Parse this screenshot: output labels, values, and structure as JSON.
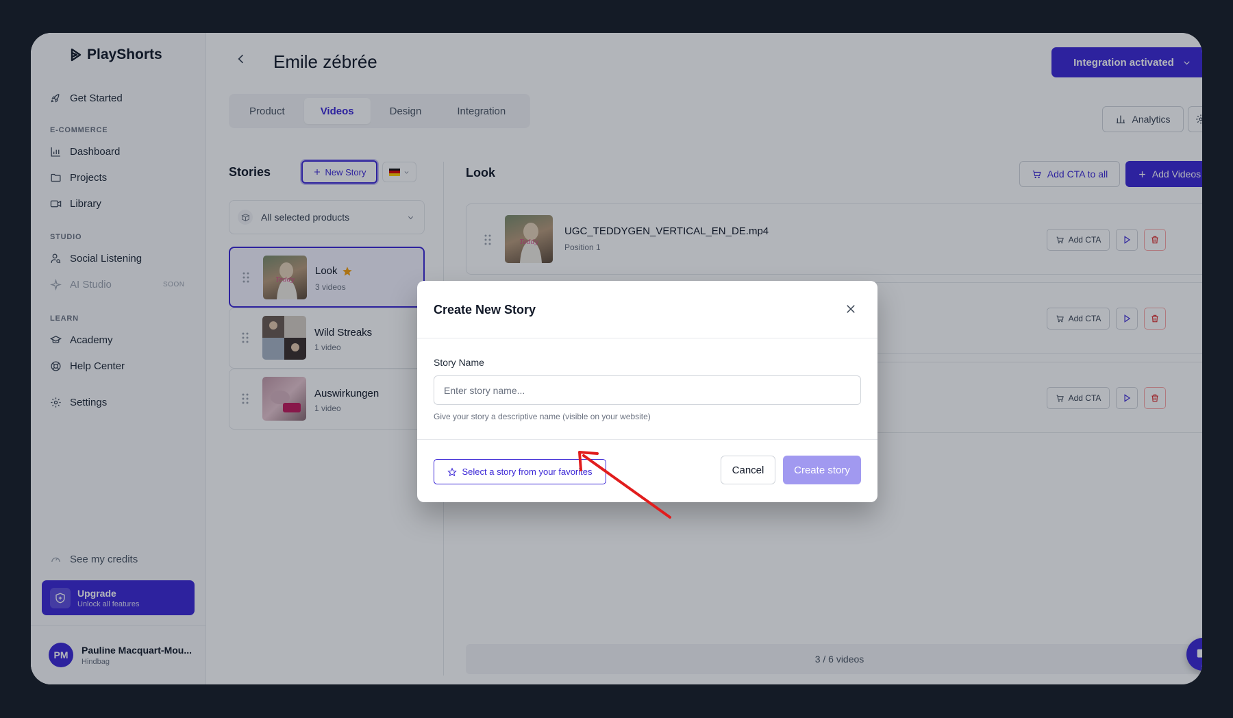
{
  "colors": {
    "accent": "#3b27d6",
    "danger": "#dc2626",
    "star": "#f59e0b",
    "annotation": "#e11d1d"
  },
  "sidebar": {
    "brand": "PlayShorts",
    "get_started": "Get Started",
    "sections": {
      "ecommerce": "E-COMMERCE",
      "studio": "STUDIO",
      "learn": "LEARN"
    },
    "dashboard": "Dashboard",
    "projects": "Projects",
    "library": "Library",
    "social_listening": "Social Listening",
    "ai_studio": "AI Studio",
    "soon": "SOON",
    "academy": "Academy",
    "help_center": "Help Center",
    "settings": "Settings",
    "credits": "See my credits",
    "upgrade": {
      "title": "Upgrade",
      "subtitle": "Unlock all features"
    },
    "user": {
      "initials": "PM",
      "name": "Pauline Macquart-Mou...",
      "org": "Hindbag"
    }
  },
  "header": {
    "title": "Emile zébrée",
    "integration": "Integration activated",
    "tabs": [
      "Product",
      "Videos",
      "Design",
      "Integration"
    ],
    "analytics": "Analytics"
  },
  "stories": {
    "title": "Stories",
    "new_story": "New Story",
    "products_filter": "All selected products",
    "items": [
      {
        "name": "Look",
        "count": "3 videos",
        "favorite": true
      },
      {
        "name": "Wild Streaks",
        "count": "1 video",
        "favorite": false
      },
      {
        "name": "Auswirkungen",
        "count": "1 video",
        "favorite": false
      }
    ]
  },
  "videos": {
    "title": "Look",
    "add_cta_all": "Add CTA to all",
    "add_videos": "Add Videos",
    "rows": [
      {
        "filename": "UGC_TEDDYGEN_VERTICAL_EN_DE.mp4",
        "position": "Position 1",
        "cta": "Add CTA"
      },
      {
        "cta": "Add CTA"
      },
      {
        "cta": "Add CTA"
      }
    ],
    "count": "3 / 6 videos"
  },
  "modal": {
    "title": "Create New Story",
    "field_label": "Story Name",
    "input_value": "",
    "input_placeholder": "Enter story name...",
    "help": "Give your story a descriptive name (visible on your website)",
    "favorites": "Select a story from your favorites",
    "cancel": "Cancel",
    "create": "Create story"
  }
}
